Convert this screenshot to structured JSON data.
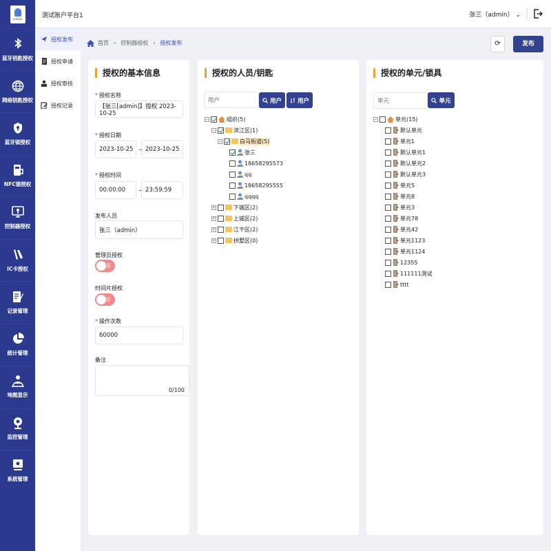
{
  "app": {
    "title": "测试账户平台1",
    "user": "张三（admin）"
  },
  "sidebar": [
    {
      "label": "蓝牙钥匙授权",
      "icon": "bluetooth-icon"
    },
    {
      "label": "网络钥匙授权",
      "icon": "globe-icon"
    },
    {
      "label": "蓝牙锁授权",
      "icon": "lock-icon"
    },
    {
      "label": "NFC锁授权",
      "icon": "nfc-icon"
    },
    {
      "label": "控制器授权",
      "icon": "monitor-icon"
    },
    {
      "label": "IC卡授权",
      "icon": "card-icon"
    },
    {
      "label": "记录管理",
      "icon": "notebook-icon"
    },
    {
      "label": "统计管理",
      "icon": "pie-chart-icon"
    },
    {
      "label": "地图显示",
      "icon": "map-person-icon"
    },
    {
      "label": "监控管理",
      "icon": "camera-icon"
    },
    {
      "label": "系统管理",
      "icon": "settings-icon"
    }
  ],
  "subnav": [
    {
      "label": "授权发布",
      "active": true,
      "icon": "send-icon"
    },
    {
      "label": "授权申请",
      "icon": "document-icon"
    },
    {
      "label": "授权审核",
      "icon": "audit-icon"
    },
    {
      "label": "授权记录",
      "icon": "edit-record-icon"
    }
  ],
  "breadcrumb": {
    "home": "首页",
    "level1": "控制器授权",
    "current": "授权发布"
  },
  "actions": {
    "refresh": "⟳",
    "publish": "发布"
  },
  "basic": {
    "title": "授权的基本信息",
    "name_label": "授权名称",
    "name_value": "【张三[admin]】授权 2023-10-25",
    "date_label": "授权日期",
    "date_start": "2023-10-25",
    "date_end": "2023-10-25",
    "tilde": "~",
    "time_label": "授权时间",
    "time_start": "00:00:00",
    "time_end": "23:59:59",
    "publisher_label": "发布人员",
    "publisher_value": "张三（admin）",
    "admin_label": "管理员授权",
    "admin_toggle": "否",
    "timeslot_label": "时间片授权",
    "timeslot_toggle": "否",
    "ops_label": "操作次数",
    "ops_value": "60000",
    "note_label": "备注",
    "note_count": "0/100"
  },
  "people": {
    "title": "授权的人员/钥匙",
    "search_placeholder": "用户",
    "btn_search": "用户",
    "btn_filter": "用户",
    "tree": [
      {
        "text": "组织(5)",
        "exp": "⊟",
        "check": true
      },
      {
        "text": "滨江区(1)",
        "exp": "⊟",
        "check": true
      },
      {
        "text": "白马街道(5)",
        "exp": "⊟",
        "check": true
      },
      {
        "text": "张三",
        "check": true
      },
      {
        "text": "18658295573"
      },
      {
        "text": "qq"
      },
      {
        "text": "18658295555"
      },
      {
        "text": "qqqq"
      },
      {
        "text": "下城区(2)",
        "exp": "⊞"
      },
      {
        "text": "上城区(2)",
        "exp": "⊞"
      },
      {
        "text": "江干区(2)",
        "exp": "⊞"
      },
      {
        "text": "拱墅区(0)",
        "exp": "⊞"
      }
    ]
  },
  "units": {
    "title": "授权的单元/锁具",
    "search_placeholder": "单元",
    "btn_search": "单元",
    "root": "单元(15)",
    "items": [
      "默认单元",
      "单元1",
      "默认单元1",
      "默认单元2",
      "默认单元3",
      "单元5",
      "单元8",
      "单元3",
      "单元78",
      "单元42",
      "单元1123",
      "单元1124",
      "12355",
      "111111测试",
      "tttt"
    ]
  }
}
